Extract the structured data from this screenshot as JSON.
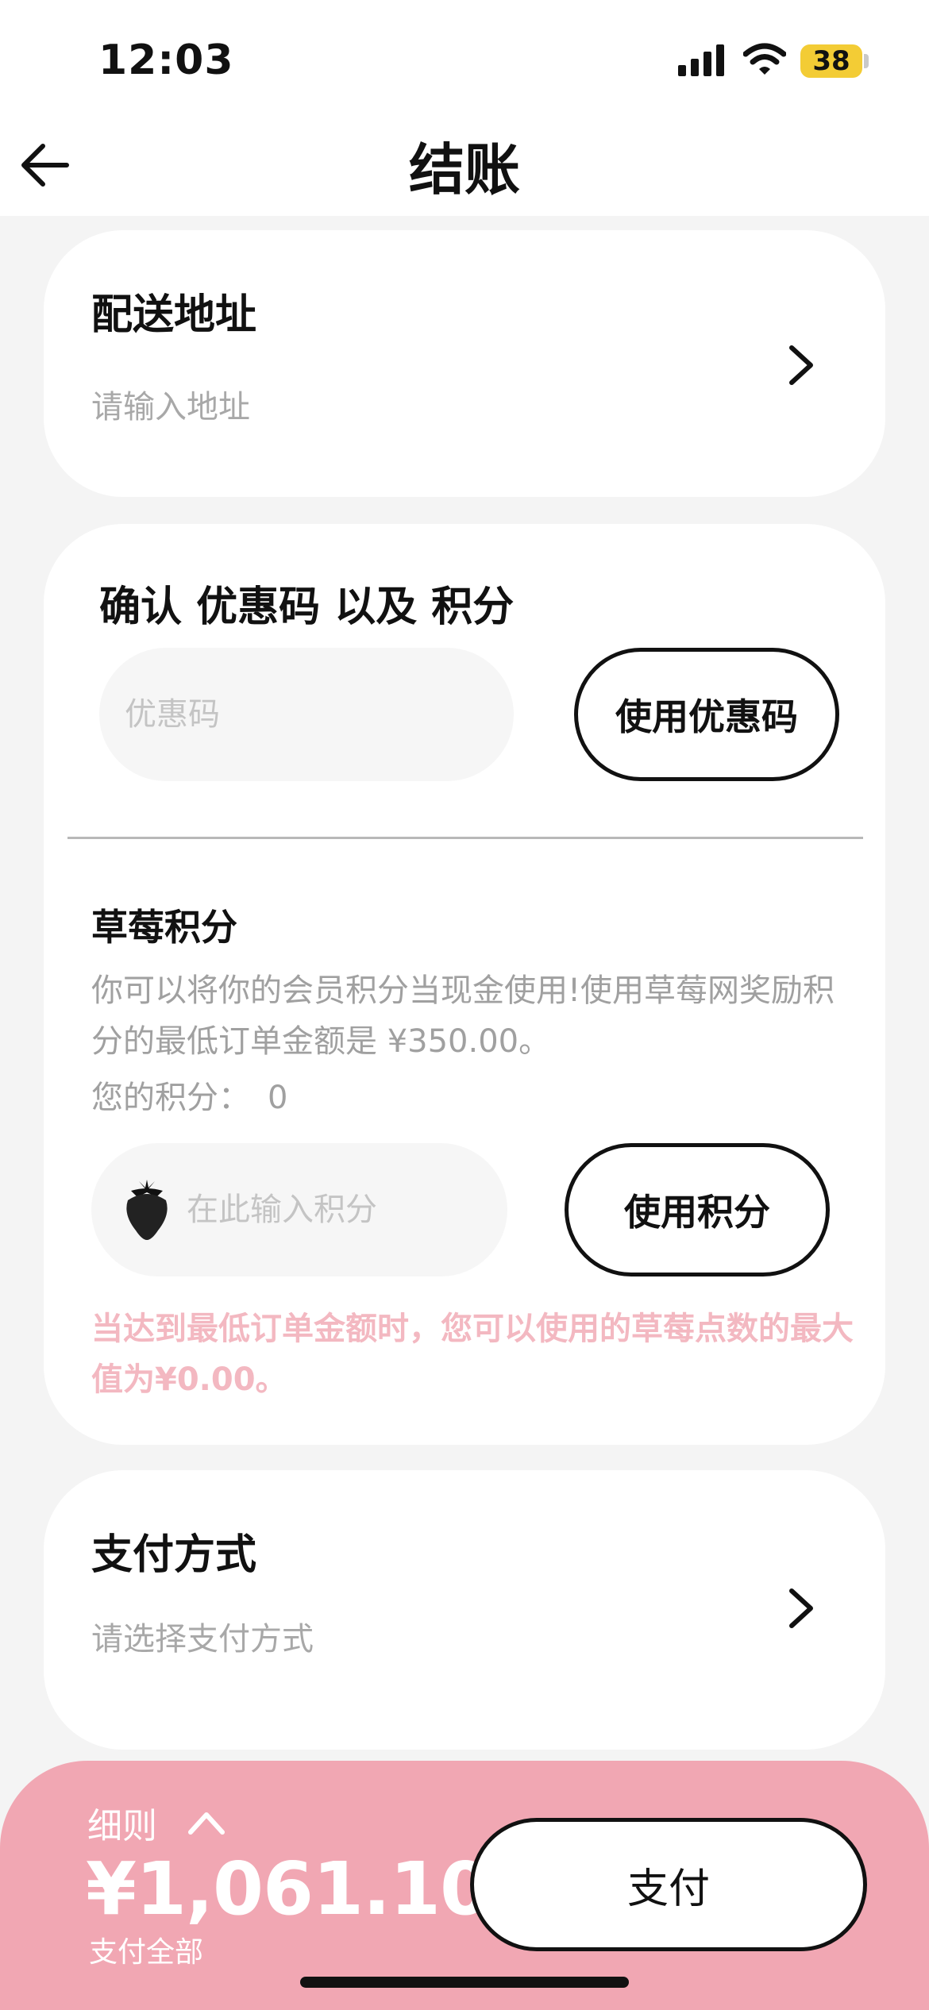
{
  "status_bar": {
    "time": "12:03",
    "battery": "38",
    "icons": [
      "signal-icon",
      "wifi-icon",
      "battery-icon"
    ],
    "battery_color": "#f3cc35"
  },
  "header": {
    "title": "结账",
    "back_icon": "arrow-left-icon"
  },
  "address": {
    "title": "配送地址",
    "placeholder": "请输入地址"
  },
  "coupon": {
    "title": "确认 优惠码 以及 积分",
    "input_placeholder": "优惠码",
    "apply_label": "使用优惠码"
  },
  "points": {
    "title": "草莓积分",
    "description": "你可以将你的会员积分当现金使用!使用草莓网奖励积分的最低订单金额是 ¥350.00。",
    "balance_label": "您的积分：",
    "balance_value": "0",
    "input_placeholder": "在此输入积分",
    "apply_label": "使用积分",
    "warning": "当达到最低订单金额时，您可以使用的草莓点数的最大值为¥0.00。",
    "warning_color": "#f3b8c1"
  },
  "payment_method": {
    "title": "支付方式",
    "placeholder": "请选择支付方式"
  },
  "footer": {
    "details_label": "细则",
    "total": "¥1,061.10",
    "total_caption": "支付全部",
    "pay_label": "支付",
    "background_color": "#f1a7b3"
  }
}
